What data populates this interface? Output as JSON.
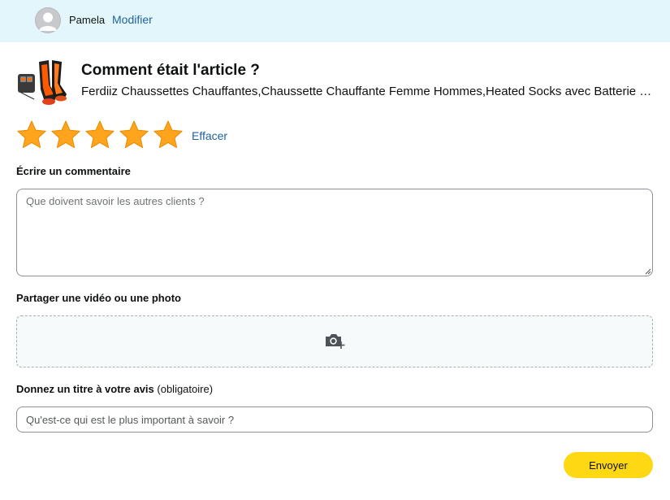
{
  "header": {
    "user_name": "Pamela",
    "edit_label": "Modifier"
  },
  "product": {
    "headline": "Comment était l'article ?",
    "name": "Ferdiiz Chaussettes Chauffantes,Chaussette Chauffante Femme Hommes,Heated Socks avec Batterie Rechargeable"
  },
  "rating": {
    "value": 5,
    "max": 5,
    "star_color": "#ffa41c",
    "clear_label": "Effacer"
  },
  "review": {
    "comment_label": "Écrire un commentaire",
    "comment_placeholder": "Que doivent savoir les autres clients ?",
    "media_label": "Partager une vidéo ou une photo",
    "media_icon": "camera-add-icon",
    "title_label": "Donnez un titre à votre avis",
    "title_required_note": "(obligatoire)",
    "title_placeholder": "Qu'est-ce qui est le plus important à savoir ?",
    "submit_label": "Envoyer"
  },
  "colors": {
    "header_bg": "#e3f6fc",
    "link": "#2162a1",
    "button": "#ffd814"
  }
}
